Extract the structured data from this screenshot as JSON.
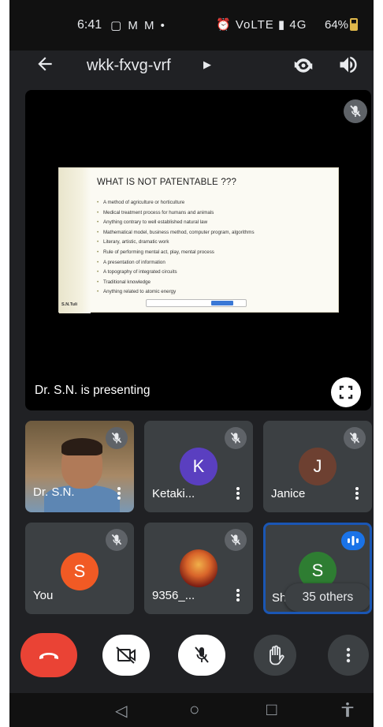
{
  "status_bar": {
    "time": "6:41",
    "left_icons": "▢ M M •",
    "right_icons": "⏰ VoLTE ▮ 4G",
    "battery_percent": "64%",
    "battery_level": 0.64
  },
  "top_bar": {
    "back_icon": "arrow-back-icon",
    "meeting_code": "wkk-fxvg-vrf",
    "meeting_details_icon": "chevron-right-icon",
    "switch_camera_icon": "camera-switch-icon",
    "audio_output_icon": "speaker-icon"
  },
  "presentation": {
    "presenter_label": "Dr. S.N. is presenting",
    "mic_state_icon": "mic-off-icon",
    "fullscreen_icon": "fullscreen-icon",
    "slide": {
      "title": "WHAT IS NOT PATENTABLE ???",
      "bullets": [
        "A method of agriculture or horticulture",
        "Medical treatment process for humans and animals",
        "Anything contrary to well established natural law",
        "Mathematical model, business method, computer program, algorithms",
        "Literary, artistic, dramatic work",
        "Rule of performing mental act, play, mental process",
        "A presentation of information",
        "A topography of integrated circuits",
        "Traditional knowledge",
        "Anything related to atomic energy"
      ],
      "author": "S.N.Tuli"
    }
  },
  "participants": [
    {
      "name": "Dr. S.N.",
      "type": "video",
      "mic": "mic-off-icon"
    },
    {
      "name": "Ketaki...",
      "initial": "K",
      "avatar_color": "#5a3fc0",
      "mic": "mic-off-icon"
    },
    {
      "name": "Janice",
      "initial": "J",
      "avatar_color": "#6d4031",
      "mic": "mic-off-icon"
    },
    {
      "name": "You",
      "initial": "S",
      "avatar_color": "#f15a24",
      "mic": "mic-off-icon"
    },
    {
      "name": "9356_...",
      "type": "photo",
      "mic": "mic-off-icon"
    },
    {
      "name": "Sh",
      "initial": "S",
      "avatar_color": "#2e7d32",
      "mic": "speaking-icon",
      "active": true
    }
  ],
  "others_count_label": "35 others",
  "controls": {
    "end_call_icon": "end-call-icon",
    "camera_icon": "camera-off-icon",
    "mic_icon": "mic-off-icon",
    "raise_hand_icon": "raise-hand-icon",
    "more_icon": "more-vert-icon"
  },
  "nav_bar": {
    "back": "◁",
    "home": "○",
    "recents": "□",
    "accessibility": "accessibility-icon"
  },
  "colors": {
    "background": "#202124",
    "tile": "#3c4043",
    "end_call": "#ea4335",
    "speaking_accent": "#1a73e8"
  }
}
